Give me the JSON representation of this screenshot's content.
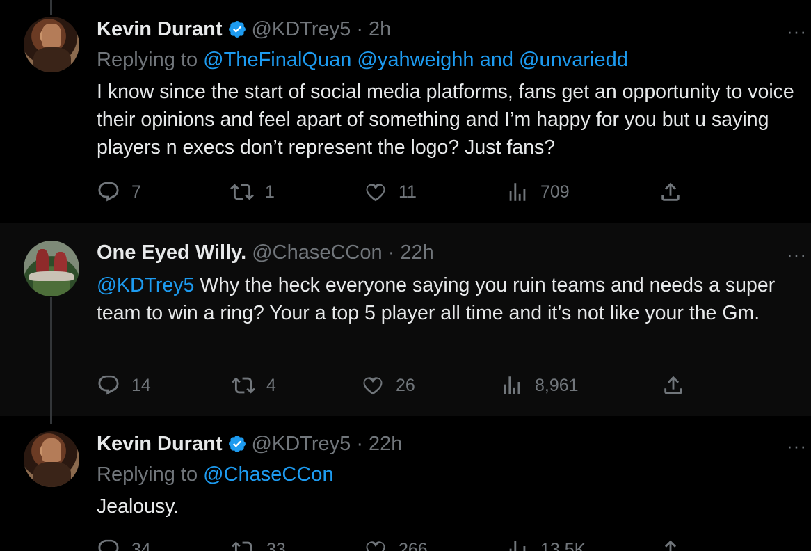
{
  "tweets": [
    {
      "name": "Kevin Durant",
      "handle": "@KDTrey5",
      "time": "· 2h",
      "verified": true,
      "reply_prefix": "Replying to ",
      "reply_links": "@TheFinalQuan @yahweighh and @unvariedd",
      "text": "I know since the start of social media platforms, fans get an opportunity to voice their opinions and feel apart of something and I’m happy for you but u saying players n execs don’t represent the logo? Just fans?",
      "more": "···",
      "replies": "7",
      "retweets": "1",
      "likes": "11",
      "views": "709"
    },
    {
      "name": "One Eyed Willy.",
      "handle": "@ChaseCCon",
      "time": "· 22h",
      "verified": false,
      "mention": "@KDTrey5",
      "text": " Why the heck everyone saying you ruin teams and needs a super team to win a ring? Your a top 5 player all time and it’s not like your the Gm.",
      "more": "···",
      "replies": "14",
      "retweets": "4",
      "likes": "26",
      "views": "8,961"
    },
    {
      "name": "Kevin Durant",
      "handle": "@KDTrey5",
      "time": "· 22h",
      "verified": true,
      "reply_prefix": "Replying to ",
      "reply_links": "@ChaseCCon",
      "text": "Jealousy.",
      "more": "···",
      "replies": "34",
      "retweets": "33",
      "likes": "266",
      "views": "13.5K"
    }
  ],
  "icons": {
    "reply": "reply-icon",
    "retweet": "retweet-icon",
    "like": "like-icon",
    "views": "views-icon",
    "share": "share-icon",
    "verified": "verified-badge-icon"
  },
  "colors": {
    "background": "#000000",
    "text": "#e7e9ea",
    "secondary": "#71767b",
    "link": "#1d9bf0",
    "verified": "#1d9bf0"
  }
}
